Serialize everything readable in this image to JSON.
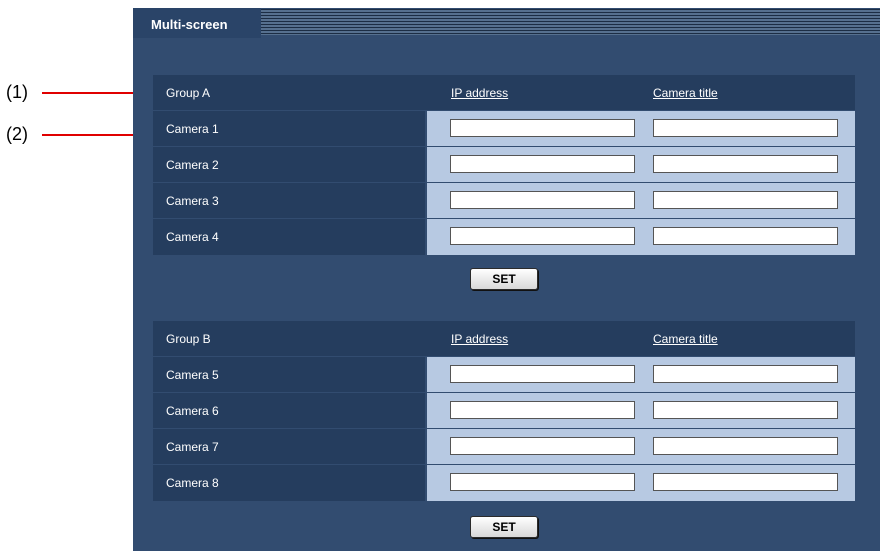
{
  "callouts": [
    "(1)",
    "(2)"
  ],
  "tab": {
    "label": "Multi-screen"
  },
  "groups": [
    {
      "name": "Group A",
      "ip_header": "IP address",
      "title_header": "Camera title",
      "cameras": [
        {
          "label": "Camera 1",
          "ip": "",
          "title": ""
        },
        {
          "label": "Camera 2",
          "ip": "",
          "title": ""
        },
        {
          "label": "Camera 3",
          "ip": "",
          "title": ""
        },
        {
          "label": "Camera 4",
          "ip": "",
          "title": ""
        }
      ],
      "button": "SET"
    },
    {
      "name": "Group B",
      "ip_header": "IP address",
      "title_header": "Camera title",
      "cameras": [
        {
          "label": "Camera 5",
          "ip": "",
          "title": ""
        },
        {
          "label": "Camera 6",
          "ip": "",
          "title": ""
        },
        {
          "label": "Camera 7",
          "ip": "",
          "title": ""
        },
        {
          "label": "Camera 8",
          "ip": "",
          "title": ""
        }
      ],
      "button": "SET"
    }
  ],
  "colors": {
    "callout": "#e00000",
    "panel": "#324c70",
    "label_cell": "#253d5e",
    "input_cell": "#b7c9e2"
  }
}
